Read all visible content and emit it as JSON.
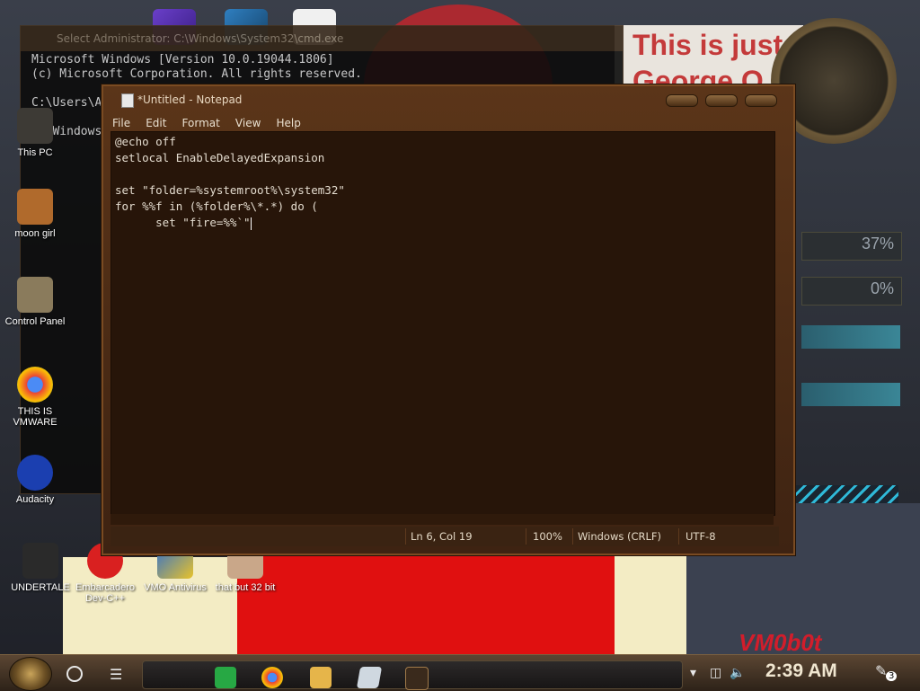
{
  "cmd": {
    "title": "Select Administrator: C:\\Windows\\System32\\cmd.exe",
    "lines": [
      "Microsoft Windows [Version 10.0.19044.1806]",
      "(c) Microsoft Corporation. All rights reserved.",
      "C:\\Users\\A",
      "C:\\Windows"
    ]
  },
  "poster": {
    "line1": "This is just",
    "line2": "George O"
  },
  "gauges": {
    "cpu": "37%",
    "ram": "0%"
  },
  "desktop_icons": [
    {
      "label": "This PC"
    },
    {
      "label": "moon girl"
    },
    {
      "label": "Control Panel"
    },
    {
      "label": "THIS IS VMWARE"
    },
    {
      "label": "Audacity"
    },
    {
      "label": "UNDERTALE"
    },
    {
      "label": "Embarcadero Dev-C++"
    },
    {
      "label": "VMO Antivirus"
    },
    {
      "label": "that but 32 bit"
    }
  ],
  "notepad": {
    "title": "*Untitled - Notepad",
    "menu": [
      "File",
      "Edit",
      "Format",
      "View",
      "Help"
    ],
    "code_lines": [
      "@echo off",
      "setlocal EnableDelayedExpansion",
      "",
      "set \"folder=%systemroot%\\system32\"",
      "for %%f in (%folder%\\*.*) do (",
      "      set \"fire=%%`\""
    ],
    "status": {
      "position": "Ln 6, Col 19",
      "zoom": "100%",
      "line_ending": "Windows (CRLF)",
      "encoding": "UTF-8"
    }
  },
  "watermark": "VM0b0t",
  "taskbar": {
    "time": "2:39 AM",
    "notification_count": "3",
    "apps": [
      "sheets-icon",
      "chrome-icon",
      "file-explorer-icon",
      "notepad-icon",
      "vmware-icon"
    ]
  },
  "colors": {
    "notepad_bg": "#271509",
    "notepad_frame": "#5b3519",
    "taskbar": "#3a2c1f"
  }
}
